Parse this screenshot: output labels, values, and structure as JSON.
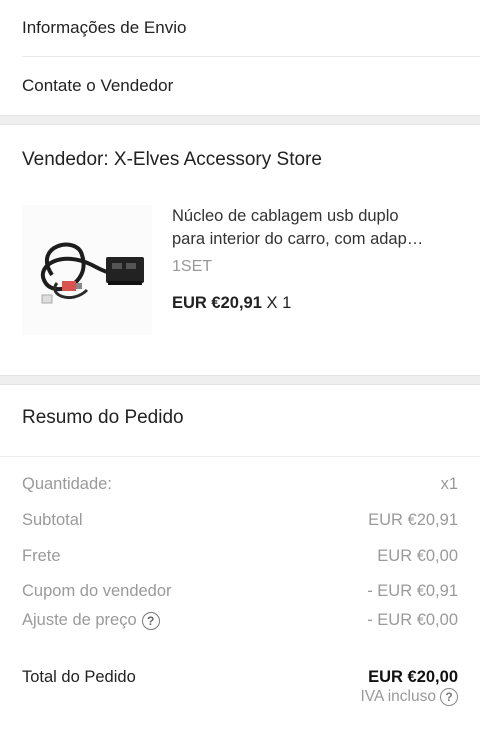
{
  "links": {
    "shipping_info": "Informações de Envio",
    "contact_seller": "Contate o Vendedor"
  },
  "seller": {
    "label": "Vendedor: X-Elves Accessory Store"
  },
  "product": {
    "name_line1": "Núcleo de cablagem usb duplo",
    "name_line2": "para interior do carro, com adap…",
    "variant": "1SET",
    "price": "EUR €20,91",
    "quantity": "X 1"
  },
  "summary": {
    "title": "Resumo do Pedido",
    "rows": [
      {
        "label": "Quantidade:",
        "value": "x1"
      },
      {
        "label": "Subtotal",
        "value": "EUR €20,91"
      },
      {
        "label": "Frete",
        "value": "EUR €0,00"
      },
      {
        "label": "Cupom do vendedor",
        "value": "- EUR €0,91"
      },
      {
        "label": "Ajuste de preço",
        "value": "- EUR €0,00"
      }
    ],
    "total_label": "Total do Pedido",
    "total_value": "EUR €20,00",
    "tax_note": "IVA incluso"
  },
  "icons": {
    "help": "question-circle-icon",
    "help_glyph": "?"
  }
}
